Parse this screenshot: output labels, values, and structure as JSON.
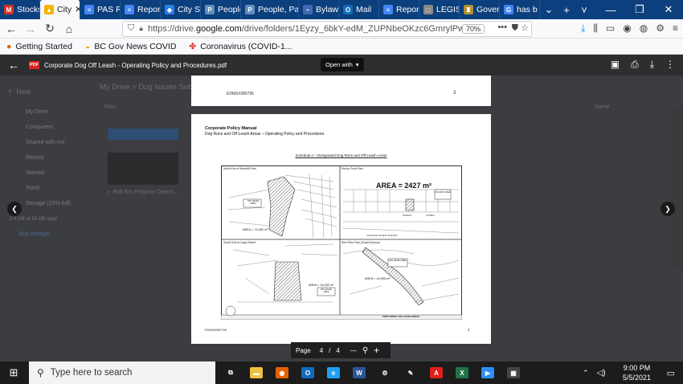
{
  "browser": {
    "tabs": [
      {
        "label": "Stocks",
        "icon_color": "#d93025",
        "icon_glyph": "M"
      },
      {
        "label": "City",
        "icon_color": "#f4b400",
        "icon_glyph": "▲",
        "active": true
      },
      {
        "label": "PAS Re",
        "icon_color": "#4285f4",
        "icon_glyph": "≡"
      },
      {
        "label": "Report",
        "icon_color": "#4285f4",
        "icon_glyph": "≡"
      },
      {
        "label": "City S",
        "icon_color": "#2a7de1",
        "icon_glyph": "◆"
      },
      {
        "label": "People",
        "icon_color": "#5f8fbf",
        "icon_glyph": "P"
      },
      {
        "label": "People, Pa",
        "icon_color": "#5f8fbf",
        "icon_glyph": "P"
      },
      {
        "label": "Bylaw",
        "icon_color": "#3d6bb3",
        "icon_glyph": "~"
      },
      {
        "label": "Mail",
        "icon_color": "#0f6cbd",
        "icon_glyph": "O"
      },
      {
        "label": "Report",
        "icon_color": "#4285f4",
        "icon_glyph": "≡"
      },
      {
        "label": "LEGIS",
        "icon_color": "#888888",
        "icon_glyph": "□"
      },
      {
        "label": "Gover",
        "icon_color": "#b08d2f",
        "icon_glyph": "♜"
      },
      {
        "label": "has b",
        "icon_color": "#4285f4",
        "icon_glyph": "G"
      }
    ],
    "new_tab": "+",
    "tab_overflow": "⌄",
    "window_controls": [
      "—",
      "❐",
      "✕"
    ],
    "url_prefix": "https://drive.",
    "url_domain": "google.com",
    "url_suffix": "/drive/folders/1Eyzy_6bkY-edM_ZUPNbeOKzc6GmrylPw",
    "zoom": "70%",
    "bookmarks": [
      {
        "label": "Getting Started",
        "icon": "firefox-icon"
      },
      {
        "label": "BC Gov News COVID",
        "icon": "bc-icon"
      },
      {
        "label": "Coronavirus (COVID-1...",
        "icon": "maple-leaf-icon"
      }
    ]
  },
  "viewer": {
    "file_title": "Corporate Dog Off Leash - Operating Policy and Procedures.pdf",
    "open_with": "Open with",
    "file_badge": "PDF"
  },
  "drive": {
    "new_label": "New",
    "nav": [
      "My Drive",
      "Computers",
      "Shared with me",
      "Recent",
      "Starred",
      "Trash",
      "Storage (15% full)"
    ],
    "storage": "2.4 GB of 15 GB used",
    "buy": "Buy storage",
    "breadcrumb": "My Drive  >  Dog Issues Sub C",
    "files_header": "Files",
    "name_header": "Name",
    "file_card": "Roll Bin Program Overvi..."
  },
  "pdf": {
    "prev_page_id": "EDMS#380795",
    "prev_page_num": "3",
    "heading": "Corporate Policy Manual",
    "subheading": "Dog Runs and Off-Leash Areas – Operating Policy and Procedures",
    "schedule_title": "Schedule A – Designated Dog Runs and Off-Leash Areas",
    "panels": [
      {
        "title": "North End of Westhill Park",
        "area": "AREA = 74,481 m²",
        "tag": "OFF LEASH AREA"
      },
      {
        "title": "Rocky Point Park",
        "area": "AREA = 2427 m²",
        "tag": "DOG RUN AREA"
      },
      {
        "title": "South End of Hugh Street",
        "area": "AREA = 94,332 m²",
        "tag": "OFF LEASH AREA"
      },
      {
        "title": "Bert Flinn Park (David Avenue)",
        "area": "AREA = 44,995 m²",
        "tag": "OFF LEASH AREA"
      }
    ],
    "map_labels": [
      "MURRAY",
      "STREET",
      "CANADIAN PACIFIC RAILWAY"
    ],
    "footer_caption": "PORT MOODY OFF LEASH AREAS",
    "page_id": "EDMS#380795",
    "page_num": "4"
  },
  "page_control": {
    "label": "Page",
    "current": "4",
    "separator": "/",
    "total": "4",
    "zoom_out": "—",
    "zoom_in": "+"
  },
  "taskbar": {
    "search_placeholder": "Type here to search",
    "apps": [
      {
        "name": "task-view-icon",
        "color": "#1c1c1c",
        "glyph": "⧉"
      },
      {
        "name": "file-explorer-icon",
        "color": "#f0c040",
        "glyph": "▬"
      },
      {
        "name": "firefox-icon",
        "color": "#e66000",
        "glyph": "◉"
      },
      {
        "name": "outlook-icon",
        "color": "#0f6cbd",
        "glyph": "O"
      },
      {
        "name": "ie-icon",
        "color": "#1da1f2",
        "glyph": "e"
      },
      {
        "name": "word-icon",
        "color": "#2b579a",
        "glyph": "W"
      },
      {
        "name": "settings-icon",
        "color": "#1c1c1c",
        "glyph": "⚙"
      },
      {
        "name": "paint-icon",
        "color": "#1c1c1c",
        "glyph": "✎"
      },
      {
        "name": "acrobat-icon",
        "color": "#e0201c",
        "glyph": "A"
      },
      {
        "name": "excel-icon",
        "color": "#217346",
        "glyph": "X"
      },
      {
        "name": "zoom-icon",
        "color": "#2d8cff",
        "glyph": "▶"
      },
      {
        "name": "calculator-icon",
        "color": "#444444",
        "glyph": "▦"
      }
    ],
    "time": "9:00 PM",
    "date": "5/5/2021"
  }
}
